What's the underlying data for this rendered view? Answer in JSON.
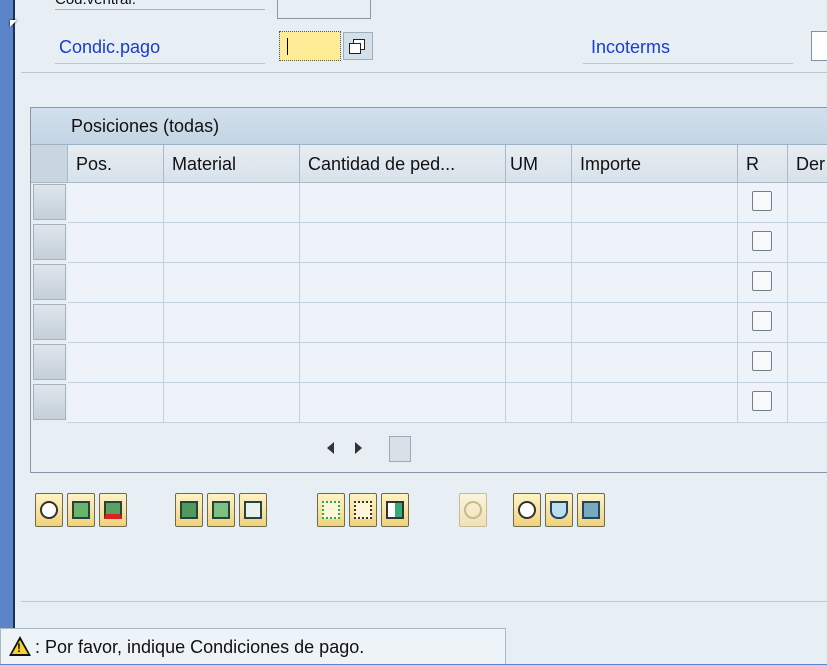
{
  "header": {
    "cut_label": "Cód.ventral.",
    "payment_terms_label": "Condic.pago",
    "payment_terms_value": "",
    "incoterms_label": "Incoterms",
    "incoterms_value": ""
  },
  "table": {
    "title": "Posiciones (todas)",
    "columns": [
      "Pos.",
      "Material",
      "Cantidad de ped...",
      "UM",
      "Importe",
      "R",
      "Der"
    ],
    "row_count": 6
  },
  "toolbar": {
    "icons": [
      "detail-icon",
      "insert-row-icon",
      "delete-row-icon",
      "select-all-icon",
      "select-block-icon",
      "deselect-icon",
      "conditions-icon",
      "schedule-icon",
      "calc-icon",
      "disabled-icon",
      "history-icon",
      "lab-icon",
      "edit-icon"
    ]
  },
  "status": {
    "message": ": Por favor, indique Condiciones de pago."
  },
  "colors": {
    "label_blue": "#1a3ccf",
    "input_focus": "#fdeb96",
    "window_bg": "#e7eff5",
    "desktop_bg": "#5b84c9"
  }
}
